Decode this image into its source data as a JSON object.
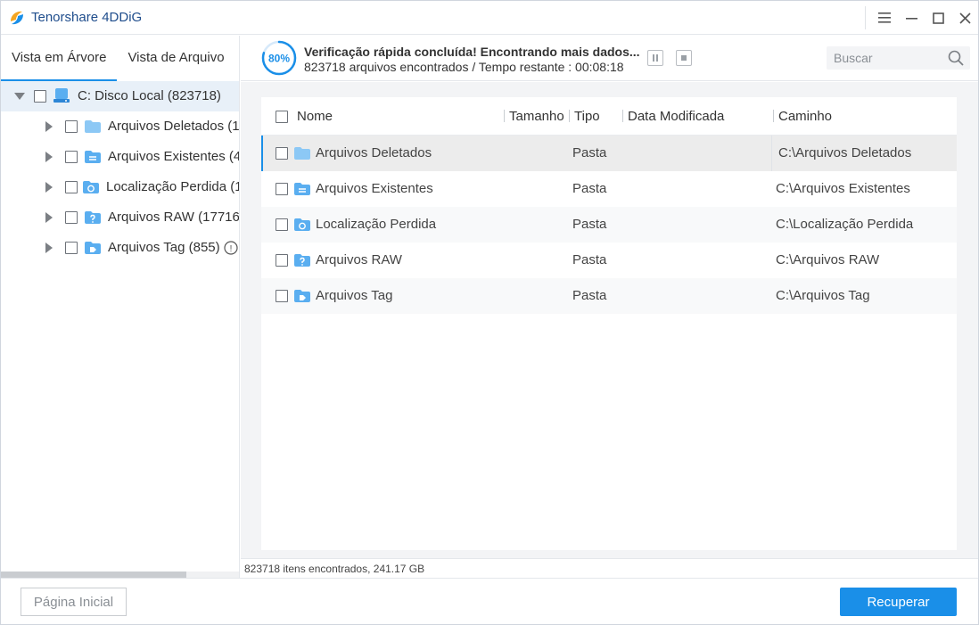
{
  "app": {
    "title": "Tenorshare 4DDiG",
    "accent_color": "#1a8fe8"
  },
  "window_controls": {
    "menu_icon": "hamburger-menu-icon",
    "minimize_icon": "minimize-icon",
    "maximize_icon": "maximize-icon",
    "close_icon": "close-icon"
  },
  "left_panel": {
    "tabs": [
      {
        "label": "Vista em Árvore",
        "active": true
      },
      {
        "label": "Vista de Arquivo",
        "active": false
      }
    ],
    "root": {
      "label": "C: Disco Local (823718)",
      "icon": "drive-icon",
      "expanded": true
    },
    "children": [
      {
        "label": "Arquivos Deletados (1",
        "icon": "folder-icon"
      },
      {
        "label": "Arquivos Existentes (4",
        "icon": "folder-existing-icon"
      },
      {
        "label": "Localização Perdida (1",
        "icon": "folder-lost-icon"
      },
      {
        "label": "Arquivos RAW (17716",
        "icon": "folder-raw-icon"
      },
      {
        "label": "Arquivos Tag (855)",
        "icon": "folder-tag-icon",
        "badge": "!"
      }
    ]
  },
  "status": {
    "progress_label": "80%",
    "progress_percent": 80,
    "title": "Verificação rápida concluída! Encontrando mais dados...",
    "files_found": "823718 arquivos encontrados /",
    "time_remaining": "Tempo restante : 00:08:18"
  },
  "search": {
    "placeholder": "Buscar",
    "value": ""
  },
  "table": {
    "columns": [
      "Nome",
      "Tamanho",
      "Tipo",
      "Data Modificada",
      "Caminho"
    ],
    "rows": [
      {
        "name": "Arquivos Deletados",
        "size": "",
        "type": "Pasta",
        "modified": "",
        "path": "C:\\Arquivos Deletados",
        "icon": "folder-icon",
        "selected": true
      },
      {
        "name": "Arquivos Existentes",
        "size": "",
        "type": "Pasta",
        "modified": "",
        "path": "C:\\Arquivos Existentes",
        "icon": "folder-existing-icon"
      },
      {
        "name": "Localização Perdida",
        "size": "",
        "type": "Pasta",
        "modified": "",
        "path": "C:\\Localização Perdida",
        "icon": "folder-lost-icon"
      },
      {
        "name": "Arquivos RAW",
        "size": "",
        "type": "Pasta",
        "modified": "",
        "path": "C:\\Arquivos RAW",
        "icon": "folder-raw-icon"
      },
      {
        "name": "Arquivos Tag",
        "size": "",
        "type": "Pasta",
        "modified": "",
        "path": "C:\\Arquivos Tag",
        "icon": "folder-tag-icon"
      }
    ]
  },
  "info_bar": {
    "text": "823718 itens encontrados, 241.17 GB"
  },
  "footer": {
    "home_label": "Página Inicial",
    "recover_label": "Recuperar"
  }
}
